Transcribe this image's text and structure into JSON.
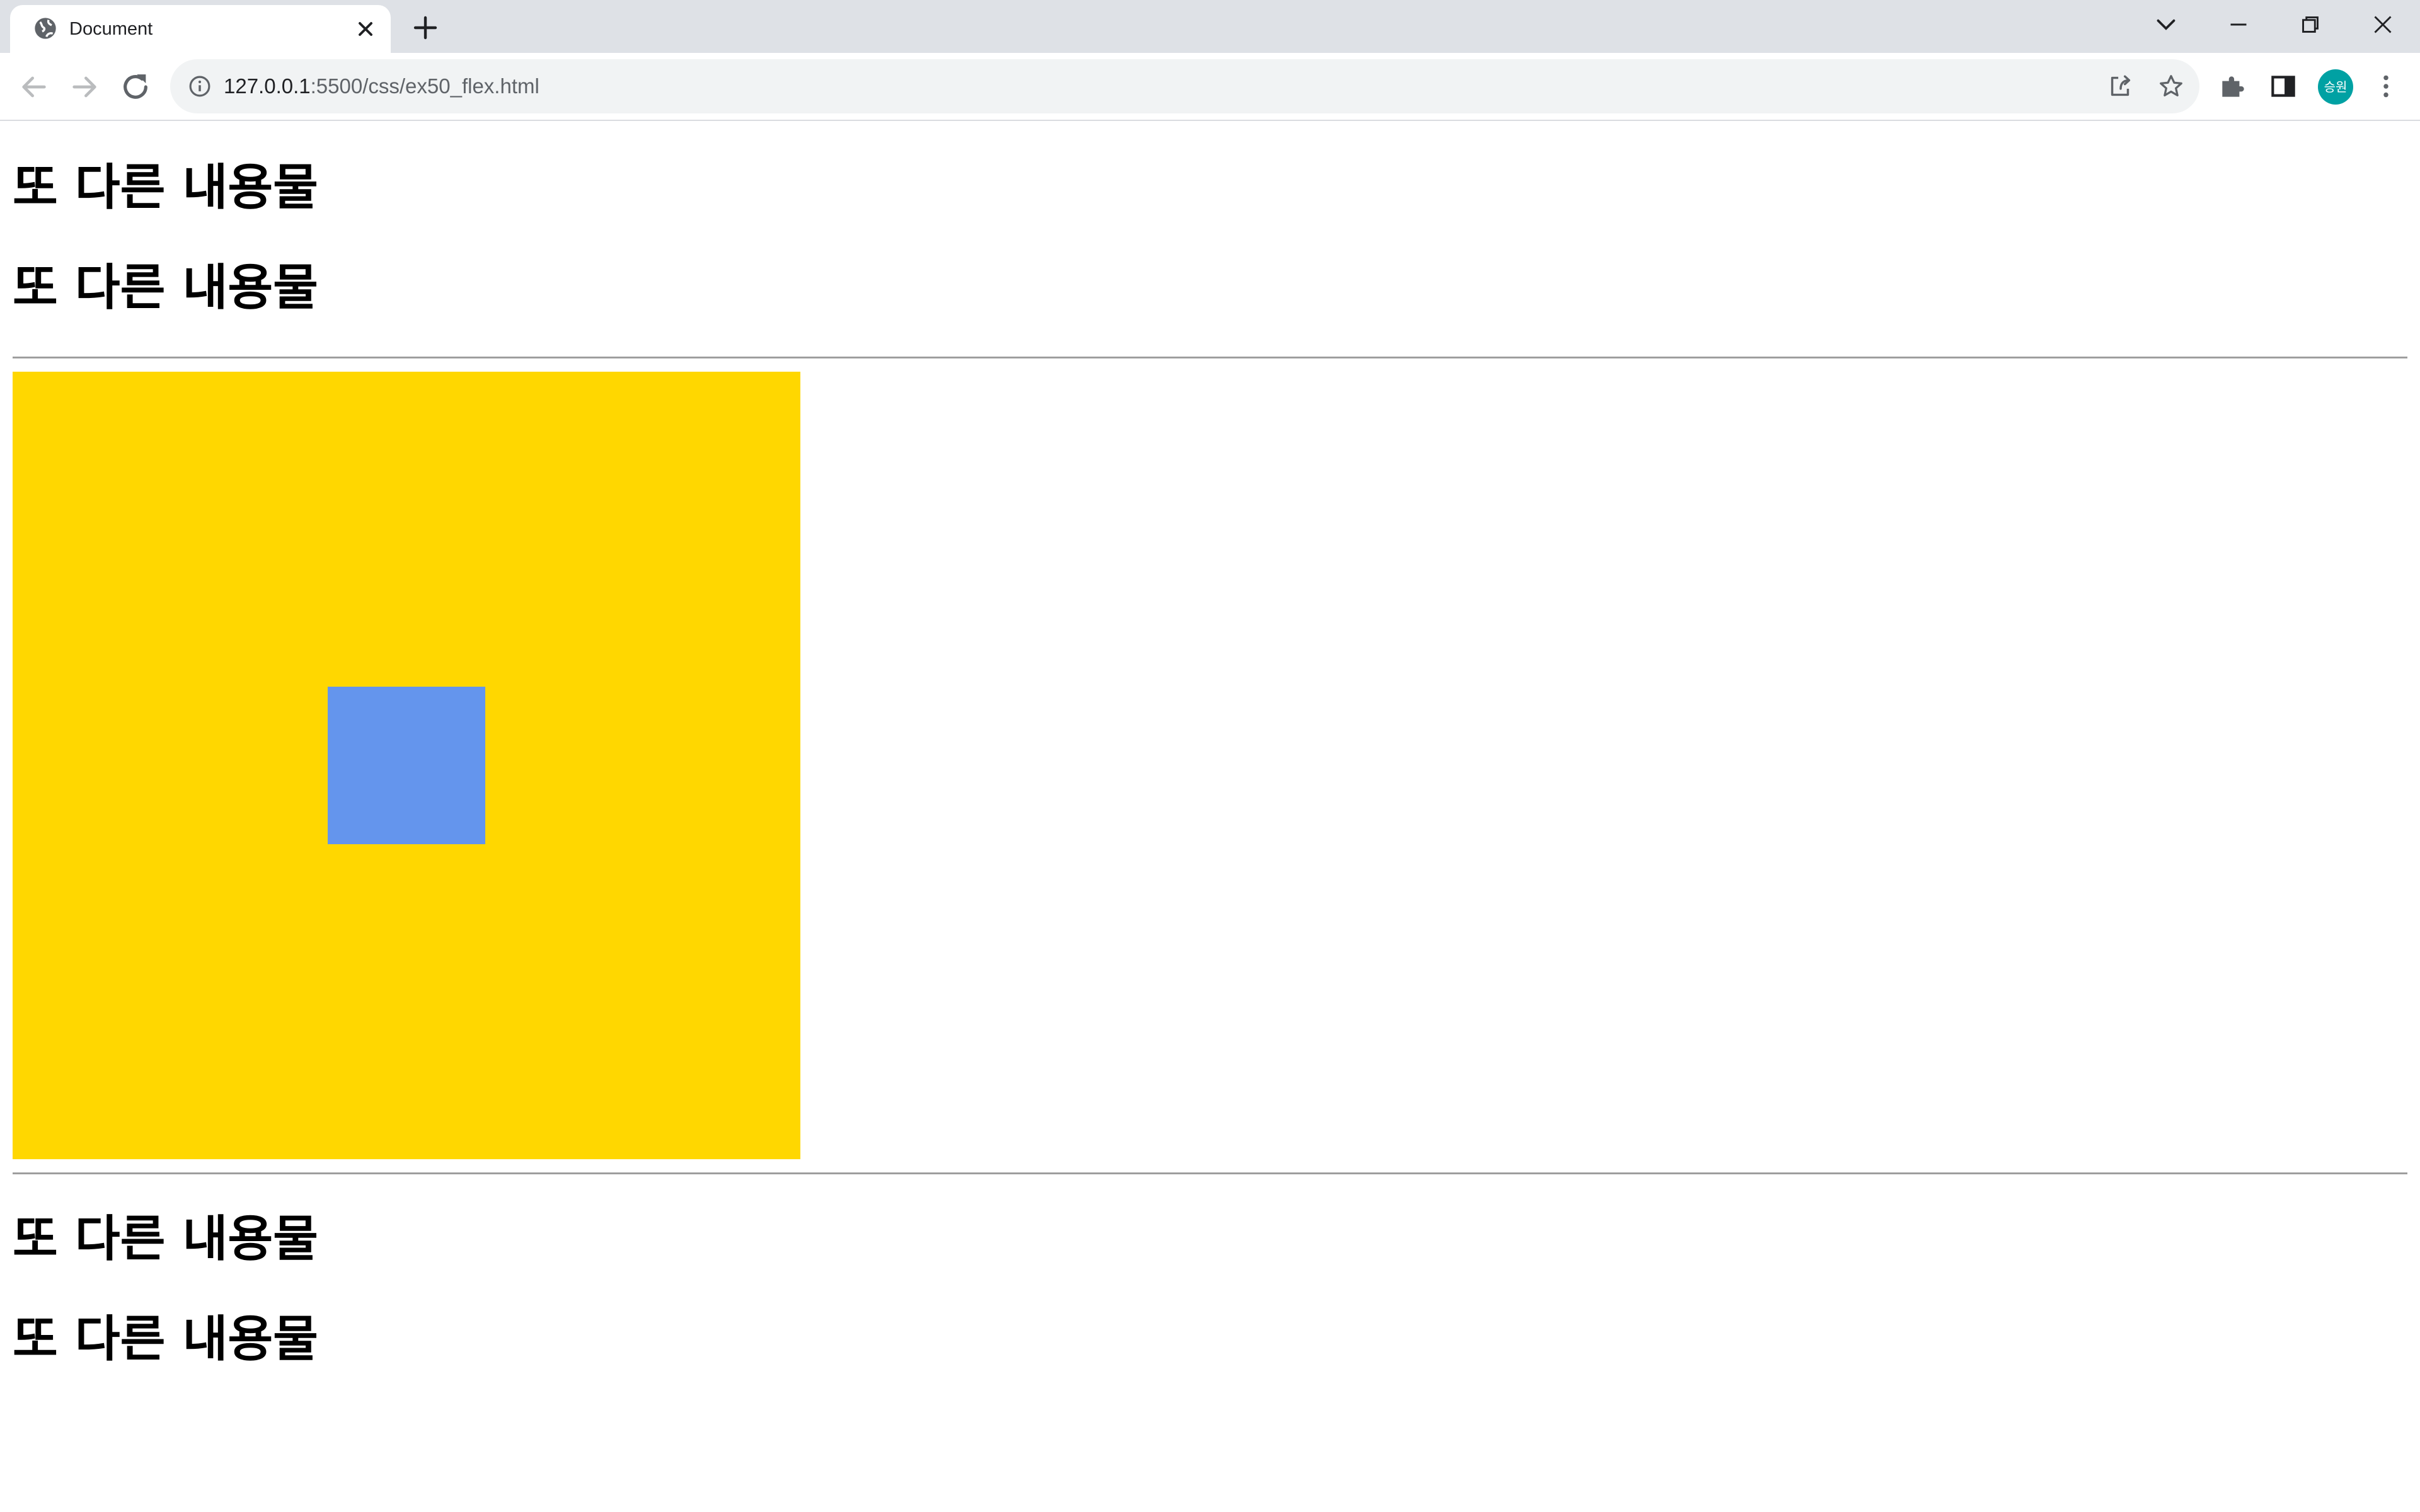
{
  "browser": {
    "tab": {
      "title": "Document",
      "favicon": "globe-icon"
    },
    "address": {
      "host": "127.0.0.1",
      "path": ":5500/css/ex50_flex.html"
    },
    "profile": {
      "initials": "승원",
      "color": "#00a1a3"
    }
  },
  "page": {
    "headings_top": [
      "또 다른 내용물",
      "또 다른 내용물"
    ],
    "headings_bottom": [
      "또 다른 내용물",
      "또 다른 내용물"
    ],
    "flex_demo": {
      "outer_color": "#ffd700",
      "inner_color": "#6495ed"
    }
  }
}
